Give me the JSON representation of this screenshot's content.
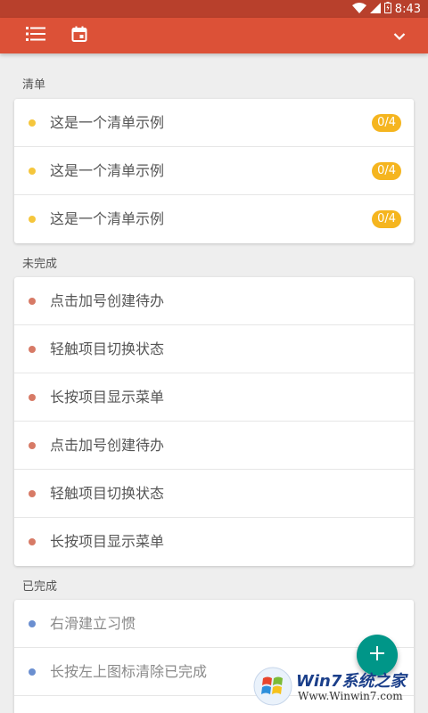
{
  "status_bar": {
    "time": "8:43"
  },
  "toolbar": {
    "list_icon": "list-icon",
    "calendar_icon": "calendar-icon",
    "dropdown_icon": "chevron-down-icon"
  },
  "sections": [
    {
      "title": "清单",
      "items": [
        {
          "label": "这是一个清单示例",
          "badge": "0/4"
        },
        {
          "label": "这是一个清单示例",
          "badge": "0/4"
        },
        {
          "label": "这是一个清单示例",
          "badge": "0/4"
        }
      ]
    },
    {
      "title": "未完成",
      "items": [
        {
          "label": "点击加号创建待办"
        },
        {
          "label": "轻触项目切换状态"
        },
        {
          "label": "长按项目显示菜单"
        },
        {
          "label": "点击加号创建待办"
        },
        {
          "label": "轻触项目切换状态"
        },
        {
          "label": "长按项目显示菜单"
        }
      ]
    },
    {
      "title": "已完成",
      "items": [
        {
          "label": "右滑建立习惯"
        },
        {
          "label": "长按左上图标清除已完成"
        }
      ]
    }
  ],
  "watermark": {
    "brand": "Win7系统之家",
    "url": "Www.Winwin7.com"
  },
  "colors": {
    "toolbar": "#dc5137",
    "status_bar": "#b8402c",
    "list_dot": "#f5c63c",
    "badge": "#f5b51f",
    "todo_dot": "#d77a66",
    "done_dot": "#6b8fd0",
    "fab": "#009688"
  }
}
